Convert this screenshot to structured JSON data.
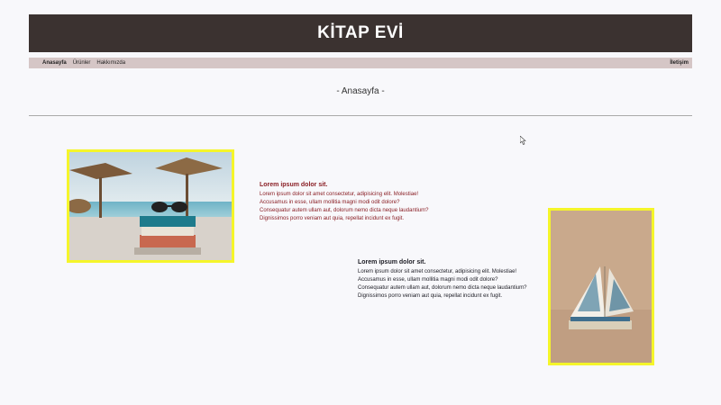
{
  "header": {
    "title": "KİTAP EVİ"
  },
  "nav": {
    "items": [
      {
        "label": "Anasayfa",
        "active": true
      },
      {
        "label": "Ürünler",
        "active": false
      },
      {
        "label": "Hakkımızda",
        "active": false
      }
    ],
    "contact": "İletişim"
  },
  "page_title": "- Anasayfa -",
  "blocks": [
    {
      "title": "Lorem ipsum dolor sit.",
      "lines": [
        "Lorem ipsum dolor sit amet consectetur, adipisicing elit. Molestiae!",
        "Accusamus in esse, ullam mollitia magni modi odit dolore?",
        "Consequatur autem ullam aut, dolorum nemo dicta neque laudantium?",
        "Dignissimos porro veniam aut quia, repellat incidunt ex fugit."
      ]
    },
    {
      "title": "Lorem ipsum dolor sit.",
      "lines": [
        "Lorem ipsum dolor sit amet consectetur, adipisicing elit. Molestiae!",
        "Accusamus in esse, ullam mollitia magni modi odit dolore?",
        "Consequatur autem ullam aut, dolorum nemo dicta neque laudantium?",
        "Dignissimos porro veniam aut quia, repellat incidunt ex fugit."
      ]
    }
  ],
  "colors": {
    "header_bg": "#3b3230",
    "nav_bg": "#d5c6c6",
    "frame": "#f5f52a",
    "block1_text": "#8a1f25"
  }
}
